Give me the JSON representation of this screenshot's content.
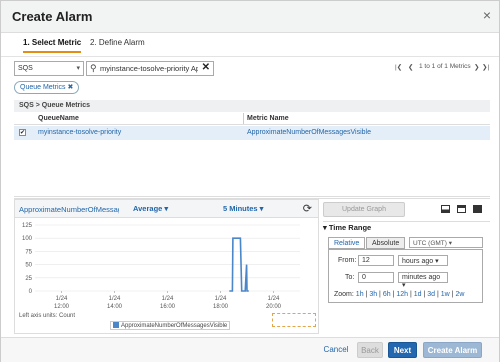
{
  "dialog": {
    "title": "Create Alarm",
    "close": "×"
  },
  "steps": [
    {
      "label": "1. Select Metric"
    },
    {
      "label": "2. Define Alarm"
    }
  ],
  "toolbar": {
    "namespace": "SQS",
    "search_value": "myinstance-tosolve-priority Ap",
    "pager_first": "|❮",
    "pager_prev": "❮",
    "pager_text": "1 to 1 of 1 Metrics",
    "pager_next": "❯",
    "pager_last": "❯|"
  },
  "filter_tag": "Queue Metrics ✖",
  "breadcrumb": "SQS > Queue Metrics",
  "table": {
    "columns": [
      "QueueName",
      "Metric Name"
    ],
    "rows": [
      {
        "checked": "✔",
        "queue": "myinstance-tosolve-priority",
        "metric": "ApproximateNumberOfMessagesVisible"
      }
    ]
  },
  "graph": {
    "metric": "ApproximateNumberOfMessag",
    "statistic": "Average ▾",
    "period": "5 Minutes ▾",
    "refresh_icon": "refresh-icon",
    "axis_units": "Left axis units:  Count",
    "legend": "ApproximateNumberOfMessagesVisible"
  },
  "chart_data": {
    "type": "line",
    "series": [
      {
        "name": "ApproximateNumberOfMessagesVisible",
        "x": [
          "18:20",
          "18:27",
          "18:28",
          "18:45",
          "18:48",
          "18:56",
          "18:59",
          "19:00",
          "19:04"
        ],
        "values": [
          0,
          0,
          100,
          100,
          0,
          0,
          50,
          0,
          0
        ]
      }
    ],
    "yticks": [
      "125",
      "100",
      "75",
      "50",
      "25",
      "0"
    ],
    "xticks": [
      [
        "1/24",
        "12:00"
      ],
      [
        "1/24",
        "14:00"
      ],
      [
        "1/24",
        "16:00"
      ],
      [
        "1/24",
        "18:00"
      ],
      [
        "1/24",
        "20:00"
      ]
    ],
    "ylim": [
      0,
      125
    ],
    "color": "#4a86c8"
  },
  "right": {
    "update_graph": "Update Graph",
    "time_range": "▾ Time Range",
    "tab_relative": "Relative",
    "tab_absolute": "Absolute",
    "timezone": "UTC (GMT) ▾",
    "from_label": "From:",
    "from_value": "12",
    "from_unit": "hours ago ▾",
    "to_label": "To:",
    "to_value": "0",
    "to_unit": "minutes ago ▾",
    "zoom_label": "Zoom:",
    "zoom": [
      "1h",
      "3h",
      "6h",
      "12h",
      "1d",
      "3d",
      "1w",
      "2w"
    ]
  },
  "footer": {
    "cancel": "Cancel",
    "back": "Back",
    "next": "Next",
    "create": "Create Alarm"
  }
}
